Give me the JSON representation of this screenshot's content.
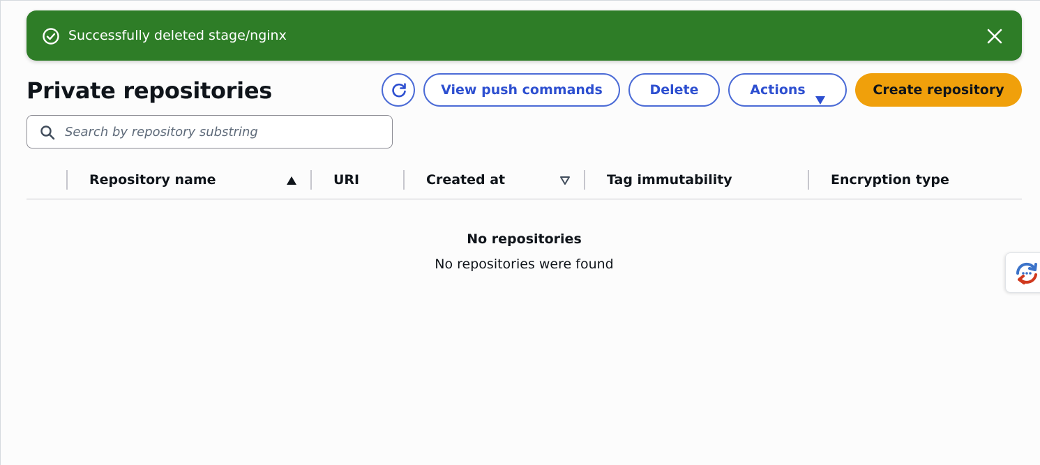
{
  "flash": {
    "message": "Successfully deleted stage/nginx",
    "icon": "check-circle-icon",
    "close_icon": "close-icon",
    "color": "#2e7d27"
  },
  "header": {
    "title": "Private repositories",
    "buttons": {
      "refresh_icon": "refresh-icon",
      "push_commands": "View push commands",
      "delete": "Delete",
      "actions": "Actions",
      "create": "Create repository"
    },
    "accent_color": "#2d4fd0",
    "primary_color": "#f0a00b"
  },
  "search": {
    "placeholder": "Search by repository substring",
    "value": ""
  },
  "table": {
    "columns": [
      {
        "label": "Repository name",
        "sort": "ascending"
      },
      {
        "label": "URI",
        "sort": "none"
      },
      {
        "label": "Created at",
        "sort": "sortable"
      },
      {
        "label": "Tag immutability",
        "sort": "none"
      },
      {
        "label": "Encryption type",
        "sort": "none"
      }
    ],
    "rows": [],
    "empty": {
      "title": "No repositories",
      "description": "No repositories were found"
    }
  },
  "side_widget": {
    "icon": "feedback-chat-icon"
  }
}
